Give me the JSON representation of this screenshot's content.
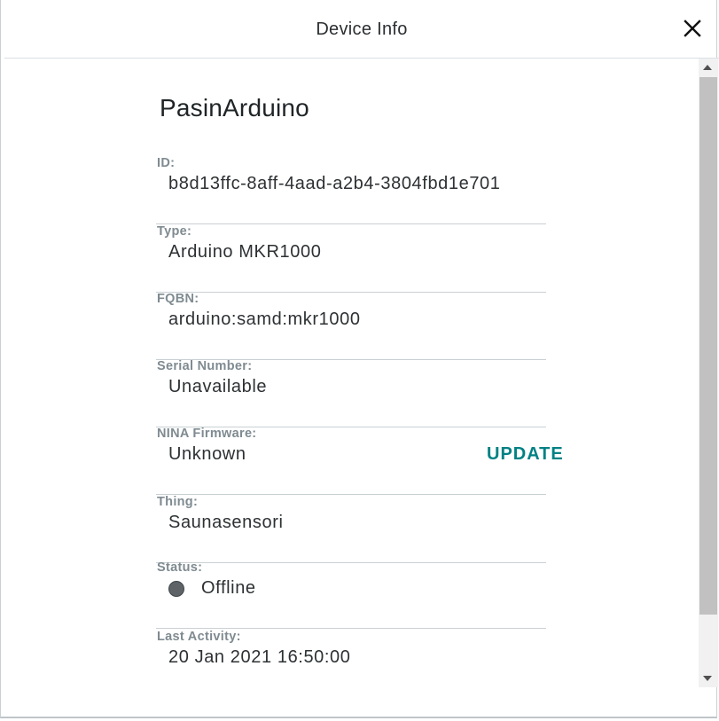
{
  "dialog": {
    "title": "Device Info",
    "close_icon": "close-icon"
  },
  "device": {
    "name": "PasinArduino",
    "fields": [
      {
        "label": "ID:",
        "value": "b8d13ffc-8aff-4aad-a2b4-3804fbd1e701"
      },
      {
        "label": "Type:",
        "value": "Arduino MKR1000"
      },
      {
        "label": "FQBN:",
        "value": "arduino:samd:mkr1000"
      },
      {
        "label": "Serial Number:",
        "value": "Unavailable"
      },
      {
        "label": "NINA Firmware:",
        "value": "Unknown",
        "action": "UPDATE"
      },
      {
        "label": "Thing:",
        "value": "Saunasensori"
      },
      {
        "label": "Status:",
        "value": "Offline",
        "status_color": "#5d6367"
      },
      {
        "label": "Last Activity:",
        "value": "20 Jan 2021 16:50:00"
      }
    ]
  },
  "colors": {
    "accent": "#008184",
    "label": "#7f8b91",
    "text": "#2d3133",
    "divider": "#c9d0d4"
  }
}
